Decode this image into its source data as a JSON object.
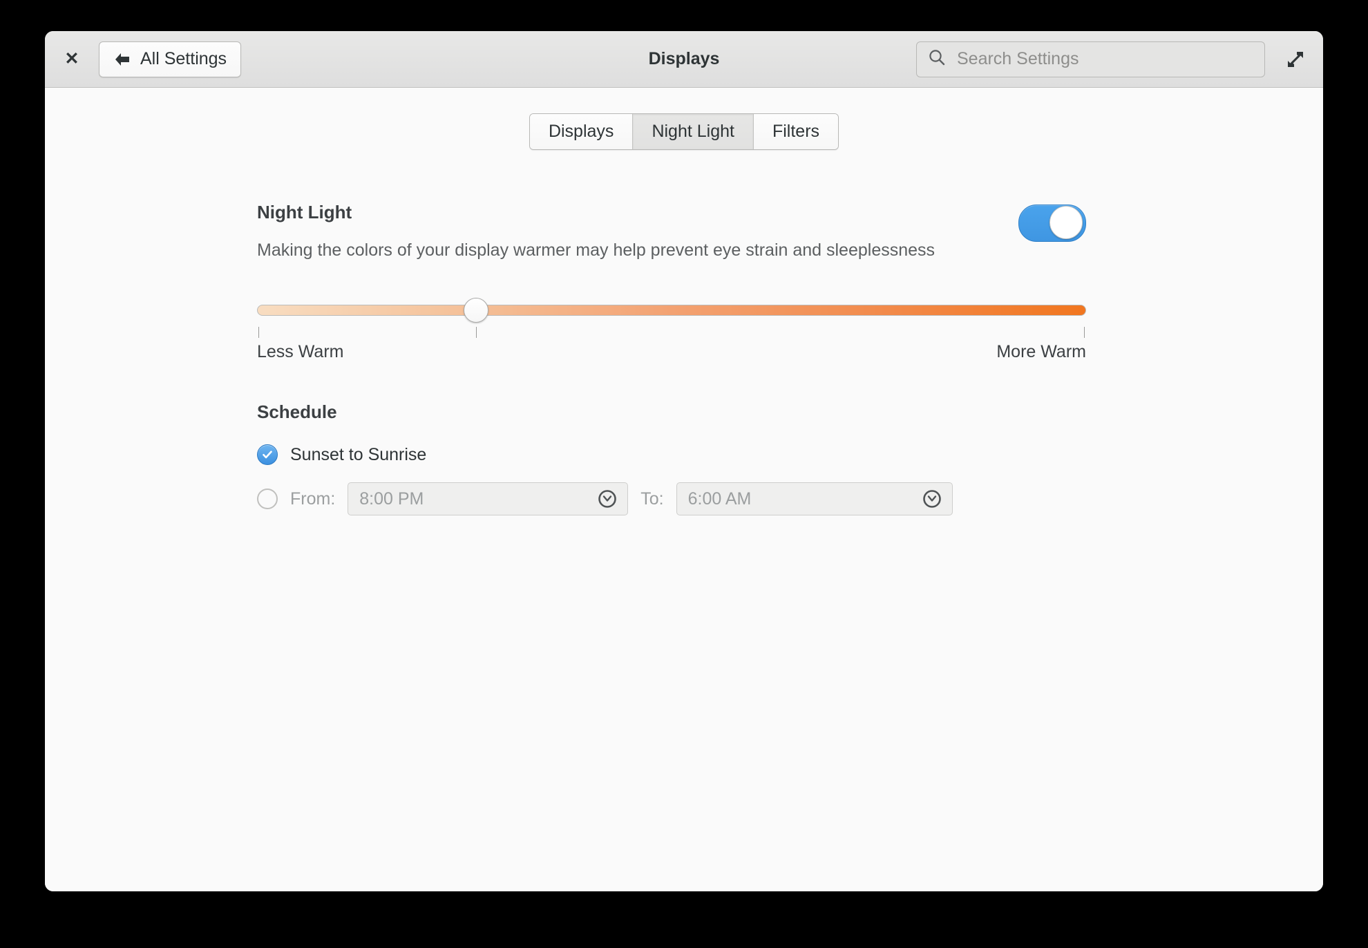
{
  "window": {
    "title": "Displays",
    "close_icon": "close-icon",
    "maximize_icon": "maximize-icon"
  },
  "header": {
    "back_button_label": "All Settings",
    "back_icon": "arrow-left-icon",
    "title": "Displays",
    "search": {
      "placeholder": "Search Settings",
      "value": "",
      "icon": "search-icon"
    }
  },
  "tabs": [
    {
      "label": "Displays",
      "active": false
    },
    {
      "label": "Night Light",
      "active": true
    },
    {
      "label": "Filters",
      "active": false
    }
  ],
  "night_light": {
    "title": "Night Light",
    "description": "Making the colors of your display warmer may help prevent eye strain and sleeplessness",
    "enabled": true,
    "toggle_color": "#3f96e2",
    "warmth_slider": {
      "min_label": "Less Warm",
      "max_label": "More Warm",
      "value_percent": 28,
      "gradient_start": "#f8ddc1",
      "gradient_end": "#f1761f"
    }
  },
  "schedule": {
    "title": "Schedule",
    "options": [
      {
        "label": "Sunset to Sunrise",
        "selected": true
      },
      {
        "label": "From:",
        "selected": false
      }
    ],
    "from": {
      "label": "From:",
      "value": "8:00 PM",
      "icon": "clock-icon"
    },
    "to": {
      "label": "To:",
      "value": "6:00 AM",
      "icon": "clock-icon"
    }
  }
}
